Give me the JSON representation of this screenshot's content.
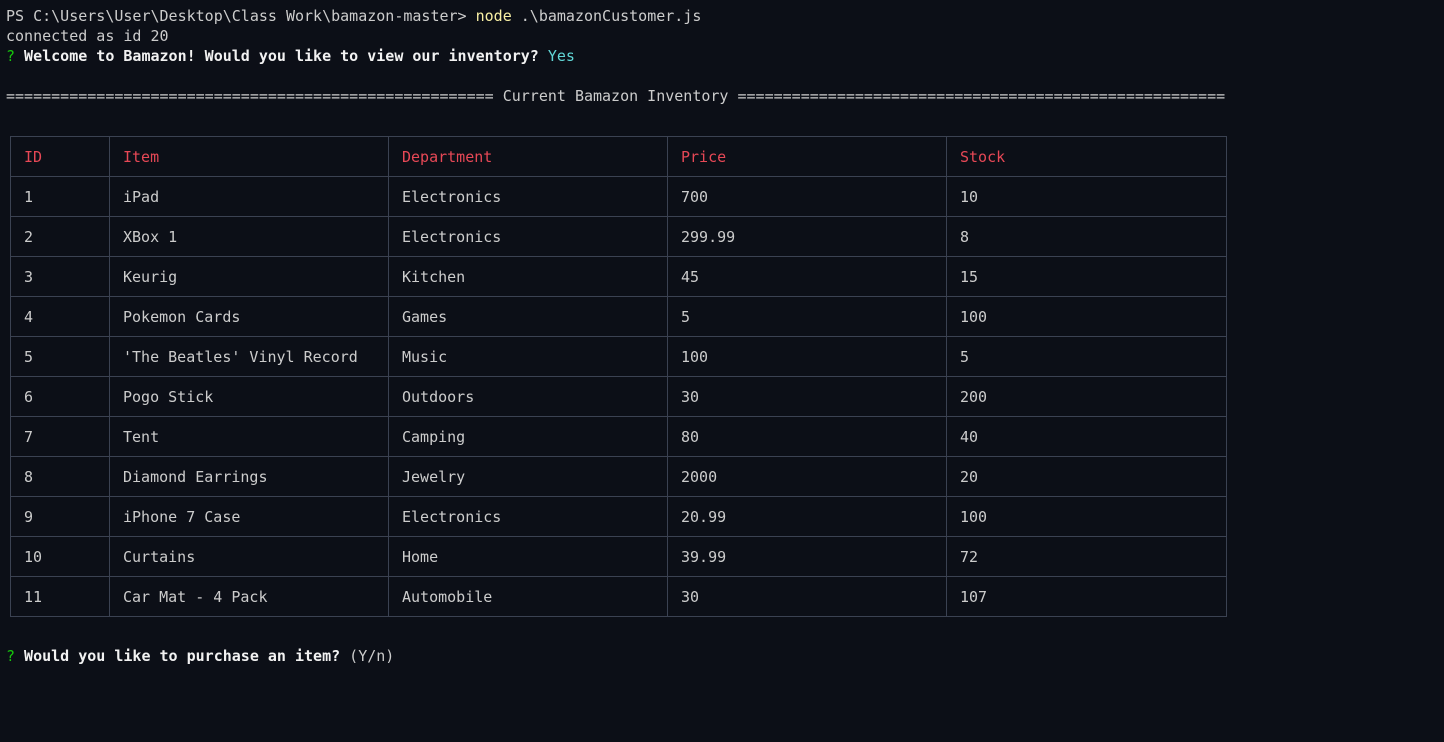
{
  "terminal": {
    "prompt": "PS C:\\Users\\User\\Desktop\\Class Work\\bamazon-master>",
    "command": "node",
    "command_args": " .\\bamazonCustomer.js",
    "connected_line": "connected as id 20",
    "question_mark": "?",
    "welcome_question": " Welcome to Bamazon! Would you like to view our inventory?",
    "welcome_answer": " Yes",
    "inventory_banner": "====================================================== Current Bamazon Inventory ======================================================",
    "purchase_question": " Would you like to purchase an item?",
    "purchase_hint": " (Y/n)"
  },
  "table": {
    "headers": [
      "ID",
      "Item",
      "Department",
      "Price",
      "Stock"
    ],
    "rows": [
      [
        "1",
        "iPad",
        "Electronics",
        "700",
        "10"
      ],
      [
        "2",
        "XBox 1",
        "Electronics",
        "299.99",
        "8"
      ],
      [
        "3",
        "Keurig",
        "Kitchen",
        "45",
        "15"
      ],
      [
        "4",
        "Pokemon Cards",
        "Games",
        "5",
        "100"
      ],
      [
        "5",
        "'The Beatles' Vinyl Record",
        "Music",
        "100",
        "5"
      ],
      [
        "6",
        "Pogo Stick",
        "Outdoors",
        "30",
        "200"
      ],
      [
        "7",
        "Tent",
        "Camping",
        "80",
        "40"
      ],
      [
        "8",
        "Diamond Earrings",
        "Jewelry",
        "2000",
        "20"
      ],
      [
        "9",
        "iPhone 7 Case",
        "Electronics",
        "20.99",
        "100"
      ],
      [
        "10",
        "Curtains",
        "Home",
        "39.99",
        "72"
      ],
      [
        "11",
        "Car Mat - 4 Pack",
        "Automobile",
        "30",
        "107"
      ]
    ]
  },
  "colors": {
    "background": "#0c0f17",
    "text": "#cccccc",
    "command": "#f9f1a5",
    "question_mark": "#16c60c",
    "answer": "#61d6d6",
    "table_header": "#e74856",
    "table_border": "#3b4252"
  }
}
